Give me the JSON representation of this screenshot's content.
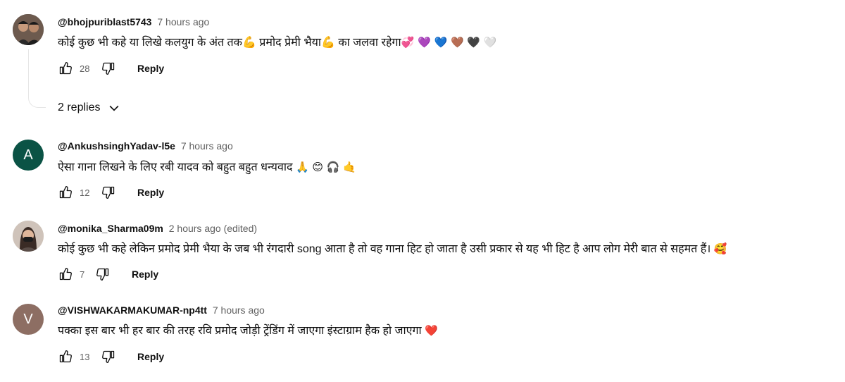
{
  "comments": [
    {
      "author": "@bhojpuriblast5743",
      "time": "7 hours ago",
      "text": "कोई कुछ भी कहे या लिखे कलयुग के अंत तक💪 प्रमोद प्रेमी भैया💪 का जलवा रहेगा",
      "emojis": "💞 💜 💙 🤎 🖤 🤍",
      "likes": "28",
      "reply_label": "Reply",
      "avatar": "photo"
    },
    {
      "author": "@AnkushsinghYadav-l5e",
      "time": "7 hours ago",
      "text": "ऐसा गाना लिखने के लिए रबी यादव को बहुत बहुत धन्यवाद",
      "emojis": "🙏 😊 🎧 🤙",
      "likes": "12",
      "reply_label": "Reply",
      "avatar": "A",
      "avatar_color": "#0b5345"
    },
    {
      "author": "@monika_Sharma09m",
      "time": "2 hours ago (edited)",
      "text": "कोई कुछ भी कहे लेकिन प्रमोद प्रेमी भैया के जब भी रंगदारी song आता है तो वह गाना हिट हो जाता है उसी प्रकार से यह भी हिट है आप लोग मेरी बात से सहमत हैं।",
      "emojis": "🥰",
      "likes": "7",
      "reply_label": "Reply",
      "avatar": "photo"
    },
    {
      "author": "@VISHWAKARMAKUMAR-np4tt",
      "time": "7 hours ago",
      "text": "पक्का इस बार भी हर बार की तरह रवि प्रमोद जोड़ी ट्रेंडिंग में जाएगा इंस्टाग्राम हैक हो जाएगा",
      "emojis": "❤️",
      "likes": "13",
      "reply_label": "Reply",
      "avatar": "V",
      "avatar_color": "#8d6e63"
    }
  ],
  "replies_toggle": {
    "label": "2 replies"
  },
  "icons": {
    "like": "thumbs-up-icon",
    "dislike": "thumbs-down-icon",
    "expand": "chevron-down-icon"
  }
}
